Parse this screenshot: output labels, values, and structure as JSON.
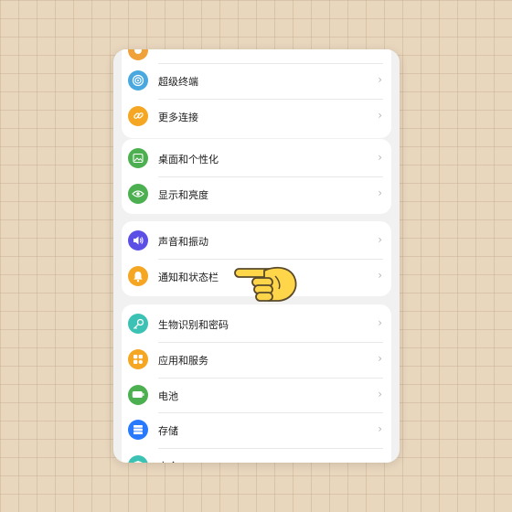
{
  "settings": {
    "group1": [
      {
        "label": "",
        "icon": "top-partial-icon",
        "color": "#f0a13a"
      },
      {
        "label": "超级终端",
        "icon": "super-device-icon",
        "color": "#4aa8e0"
      },
      {
        "label": "更多连接",
        "icon": "link-icon",
        "color": "#f5a623"
      }
    ],
    "group2": [
      {
        "label": "桌面和个性化",
        "icon": "wallpaper-icon",
        "color": "#4caf50"
      },
      {
        "label": "显示和亮度",
        "icon": "eye-icon",
        "color": "#4caf50"
      }
    ],
    "group3": [
      {
        "label": "声音和振动",
        "icon": "speaker-icon",
        "color": "#5b4fe6"
      },
      {
        "label": "通知和状态栏",
        "icon": "bell-icon",
        "color": "#f5a623"
      }
    ],
    "group4": [
      {
        "label": "生物识别和密码",
        "icon": "key-icon",
        "color": "#3cc2b4"
      },
      {
        "label": "应用和服务",
        "icon": "apps-grid-icon",
        "color": "#f5a623"
      },
      {
        "label": "电池",
        "icon": "battery-icon",
        "color": "#4caf50"
      },
      {
        "label": "存储",
        "icon": "storage-icon",
        "color": "#2979ff"
      },
      {
        "label": "安全",
        "icon": "security-icon",
        "color": "#3cc2b4"
      }
    ],
    "chevron": "›"
  },
  "pointer": {
    "icon": "pointing-hand-icon"
  }
}
